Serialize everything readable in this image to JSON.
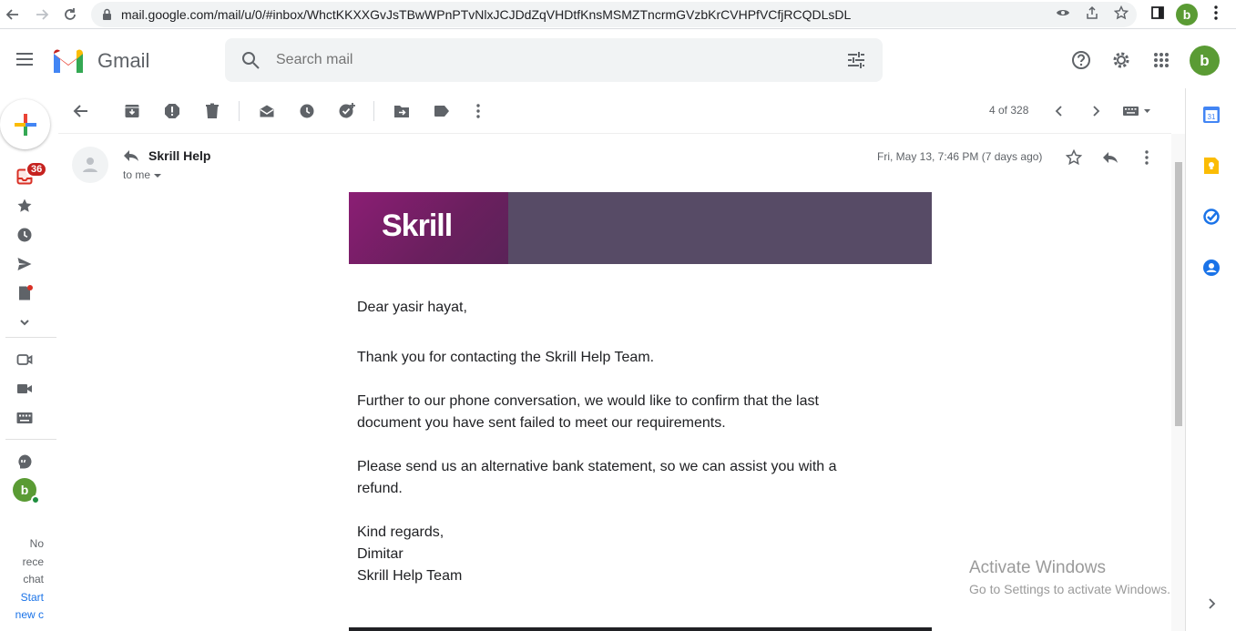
{
  "browser": {
    "url": "mail.google.com/mail/u/0/#inbox/WhctKKXXGvJsTBwWPnPTvNlxJCJDdZqVHDtfKnsMSMZTncrmGVzbKrCVHPfVCfjRCQDLsDL",
    "profile_initial": "b"
  },
  "header": {
    "app_name": "Gmail",
    "search_placeholder": "Search mail",
    "account_initial": "b"
  },
  "rail": {
    "inbox_badge": "36",
    "chat_avatar_initial": "b",
    "chat_lines": [
      "No",
      "rece",
      "chat"
    ],
    "start_link_lines": [
      "Start",
      "new c"
    ]
  },
  "toolbar": {
    "pager": "4 of 328"
  },
  "message": {
    "sender": "Skrill Help",
    "to": "to me",
    "date": "Fri, May 13, 7:46 PM (7 days ago)"
  },
  "email": {
    "brand": "Skrill",
    "greeting": "Dear yasir hayat,",
    "p1": "Thank you for contacting the Skrill Help Team.",
    "p2_l1": "Further to our phone conversation, we would like to confirm that the last",
    "p2_l2": "document you have sent failed to meet our requirements.",
    "p3_l1": "Please send us an alternative bank statement, so we can assist you with a",
    "p3_l2": "refund.",
    "sign1": "Kind regards,",
    "sign2": "Dimitar",
    "sign3": "Skrill Help Team"
  },
  "watermark": {
    "line1": "Activate Windows",
    "line2": "Go to Settings to activate Windows."
  },
  "colors": {
    "brand_red": "#ea4335",
    "skrill_purple": "#862165",
    "banner_gray": "#574b66",
    "badge_red": "#c5221f",
    "avatar_green": "#5a9b34"
  }
}
